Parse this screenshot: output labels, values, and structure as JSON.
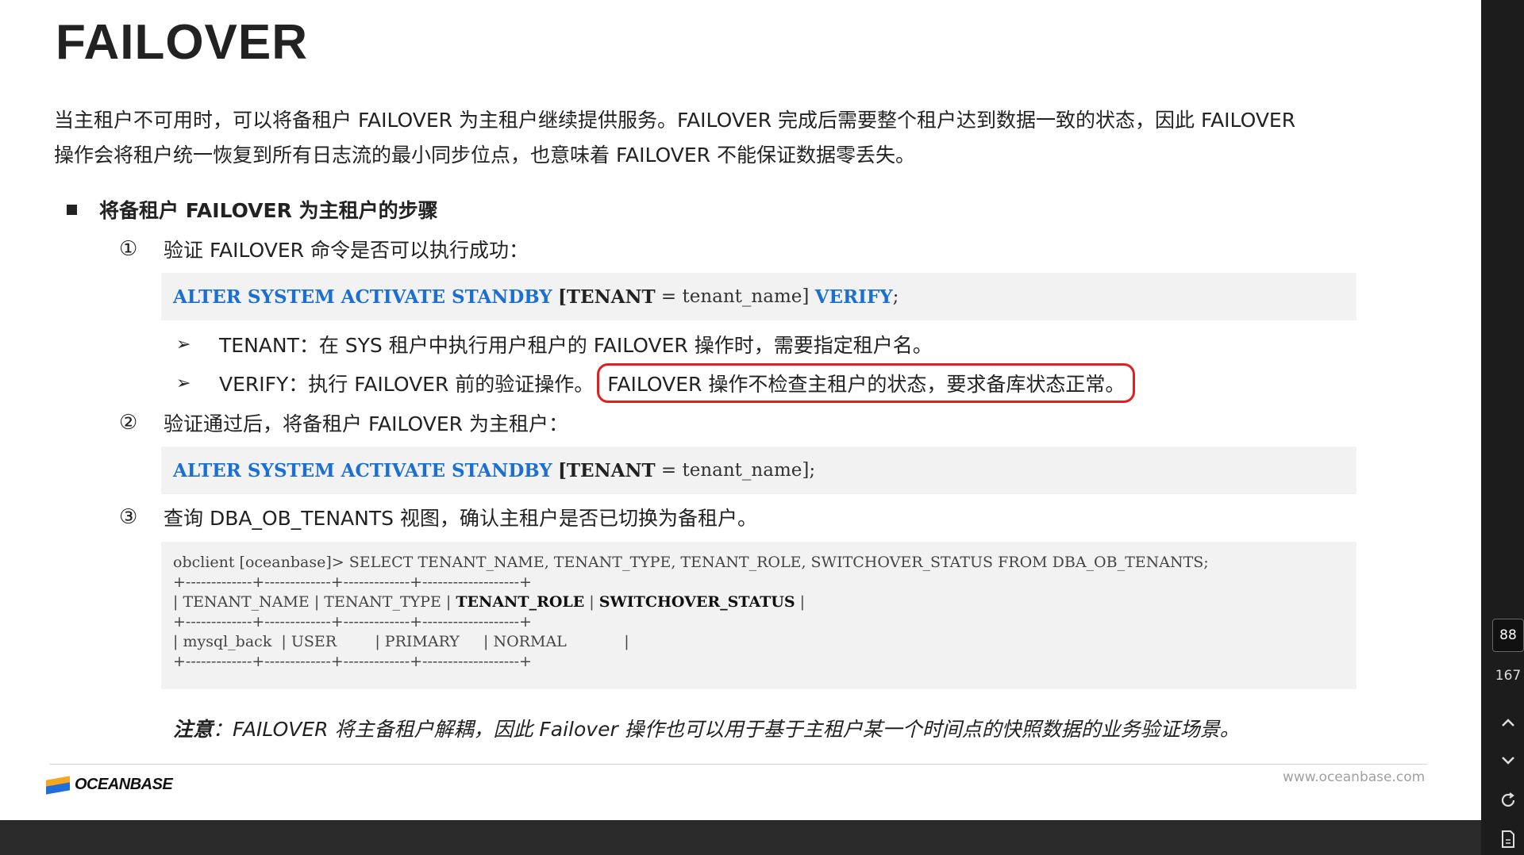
{
  "slide": {
    "title": "FAILOVER",
    "intro": [
      "当主租户不可用时，可以将备租户 FAILOVER 为主租户继续提供服务。FAILOVER 完成后需要整个租户达到数据一致的状态，因此 FAILOVER",
      "操作会将租户统一恢复到所有日志流的最小同步位点，也意味着 FAILOVER 不能保证数据零丢失。"
    ],
    "bullet": "将备租户 FAILOVER 为主租户的步骤",
    "steps": [
      {
        "num": "①",
        "text": "验证 FAILOVER 命令是否可以执行成功："
      },
      {
        "num": "②",
        "text": "验证通过后，将备租户 FAILOVER 为主租户："
      },
      {
        "num": "③",
        "text": "查询 DBA_OB_TENANTS 视图，确认主租户是否已切换为备租户。"
      }
    ],
    "code1": {
      "kw1": "ALTER SYSTEM ACTIVATE STANDBY",
      "bracket_open": "[TENANT",
      "middle": " = tenant_name]",
      "kw2": "VERIFY",
      "end": ";"
    },
    "code2": {
      "kw1": "ALTER SYSTEM ACTIVATE STANDBY",
      "bracket_open": "[TENANT",
      "middle": " = tenant_name];"
    },
    "sub_items": [
      {
        "arrow": "➢",
        "text": "TENANT：在 SYS 租户中执行用户租户的 FAILOVER 操作时，需要指定租户名。"
      },
      {
        "arrow": "➢",
        "text": "VERIFY：执行 FAILOVER 前的验证操作。",
        "highlight": "FAILOVER 操作不检查主租户的状态，要求备库状态正常。"
      }
    ],
    "terminal": {
      "command": "obclient [oceanbase]> SELECT TENANT_NAME, TENANT_TYPE, TENANT_ROLE, SWITCHOVER_STATUS FROM DBA_OB_TENANTS;",
      "border": "+-------------+-------------+-------------+-------------------+",
      "header_a": "| TENANT_NAME | TENANT_TYPE | ",
      "header_b": "TENANT_ROLE",
      "header_c": " | ",
      "header_d": "SWITCHOVER_STATUS",
      "header_e": " |",
      "row": "| mysql_back  | USER        | PRIMARY     | NORMAL            |"
    },
    "note_label": "注意",
    "note_text": "：FAILOVER 将主备租户解耦，因此 Failover 操作也可以用于基于主租户某一个时间点的快照数据的业务验证场景。",
    "logo_text": "OCEANBASE",
    "website": "www.oceanbase.com"
  },
  "viewer": {
    "current_page": "88",
    "total_pages": "167",
    "icons": [
      "chevron-up-icon",
      "chevron-down-icon",
      "refresh-icon",
      "document-icon"
    ]
  },
  "colors": {
    "keyword": "#1b6fd1",
    "highlight_border": "#e02020",
    "code_bg": "#f2f2f2"
  }
}
